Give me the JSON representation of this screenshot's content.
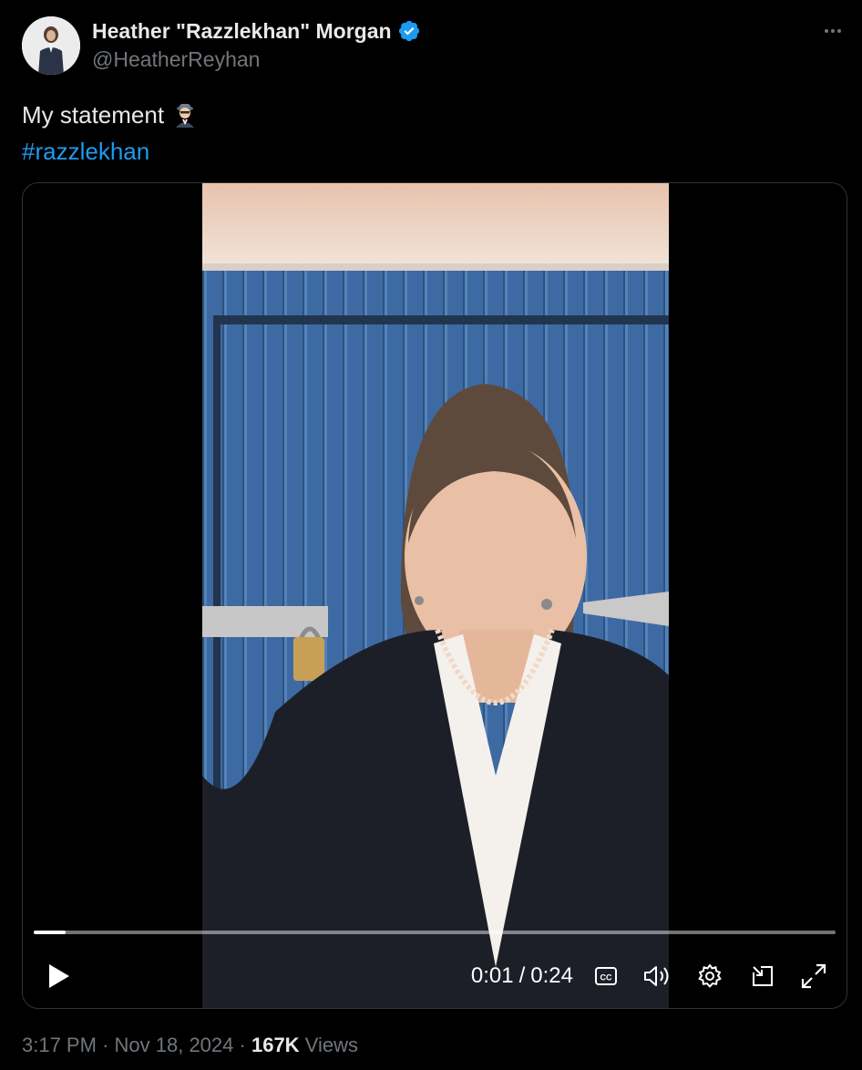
{
  "author": {
    "display_name": "Heather \"Razzlekhan\" Morgan",
    "handle": "@HeatherReyhan",
    "verified_icon": "verified-badge-icon",
    "verified_color": "#1d9bf0"
  },
  "tweet": {
    "text": "My statement",
    "emoji": "woman-detective-emoji",
    "hashtag": "#razzlekhan"
  },
  "video": {
    "current_time": "0:01",
    "separator": "/",
    "duration": "0:24",
    "progress_fraction": 0.04,
    "controls": [
      "play-icon",
      "captions-icon",
      "volume-icon",
      "settings-icon",
      "pip-icon",
      "fullscreen-icon"
    ]
  },
  "meta": {
    "time": "3:17 PM",
    "dot": "·",
    "date": "Nov 18, 2024",
    "views_count": "167K",
    "views_label": "Views"
  },
  "colors": {
    "background": "#000000",
    "text_primary": "#e7e9ea",
    "text_secondary": "#71767b",
    "link": "#1d9bf0"
  }
}
